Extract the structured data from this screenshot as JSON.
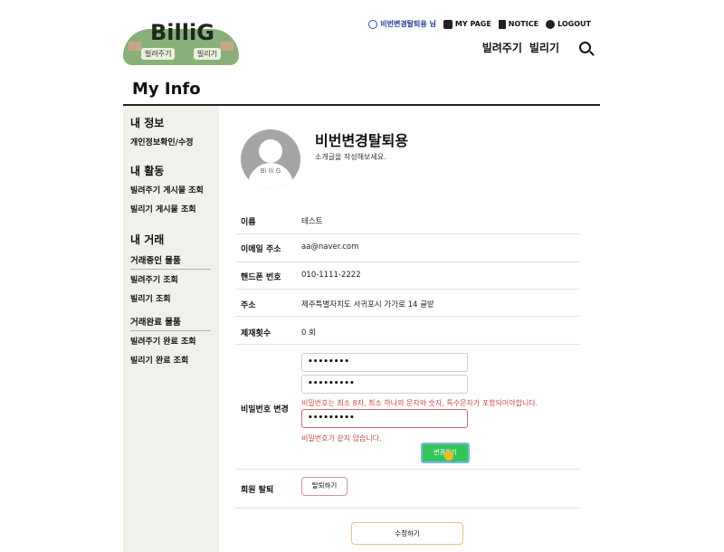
{
  "logo": {
    "title": "BilliG",
    "tag_lend": "빌려주기",
    "tag_borrow": "빌리기"
  },
  "header": {
    "user_name": "비번변경탈퇴용 님",
    "my_page": "MY PAGE",
    "notice": "NOTICE",
    "logout": "LOGOUT",
    "nav_lend": "빌려주기",
    "nav_borrow": "빌리기"
  },
  "page_title": "My Info",
  "sidebar": {
    "section1_title": "내 정보",
    "section1_item": "개인정보확인/수정",
    "section2_title": "내 활동",
    "section2_items": [
      "빌려주기 게시물 조회",
      "빌리기 게시물 조회"
    ],
    "section3_title": "내 거래",
    "in_progress_title": "거래중인 물품",
    "in_progress_items": [
      "빌려주기 조회",
      "빌리기 조회"
    ],
    "done_title": "거래완료 물품",
    "done_items": [
      "빌려주기 완료 조회",
      "빌리기 완료 조회"
    ]
  },
  "profile": {
    "avatar_text": "Bi lli G",
    "nickname": "비번변경탈퇴용",
    "intro": "소개글을 작성해보세요."
  },
  "info": {
    "name_label": "이름",
    "name_value": "테스트",
    "email_label": "이메일 주소",
    "email_value": "aa@naver.com",
    "phone_label": "핸드폰 번호",
    "phone_value": "010-1111-2222",
    "address_label": "주소",
    "address_value": "제주특별자치도 서귀포시 가가로 14 글밭",
    "sanction_label": "제재횟수",
    "sanction_value": "0 회"
  },
  "password": {
    "label": "비밀번호 변경",
    "current": "••••••••",
    "new": "•••••••••",
    "rule_message": "비밀번호는 최소 8자, 최소 하나의 문자와 숫자, 특수문자가 포함되어야합니다.",
    "confirm": "•••••••••",
    "mismatch_message": "비밀번호가 같지 않습니다.",
    "change_button": "변경하기"
  },
  "withdraw": {
    "label": "회원 탈퇴",
    "button": "탈퇴하기"
  },
  "edit_button": "수정하기",
  "colors": {
    "accent_green": "#34c55a",
    "error_red": "#c84a4a",
    "user_blue": "#23409a",
    "sidebar_bg": "#f2f0ea"
  }
}
